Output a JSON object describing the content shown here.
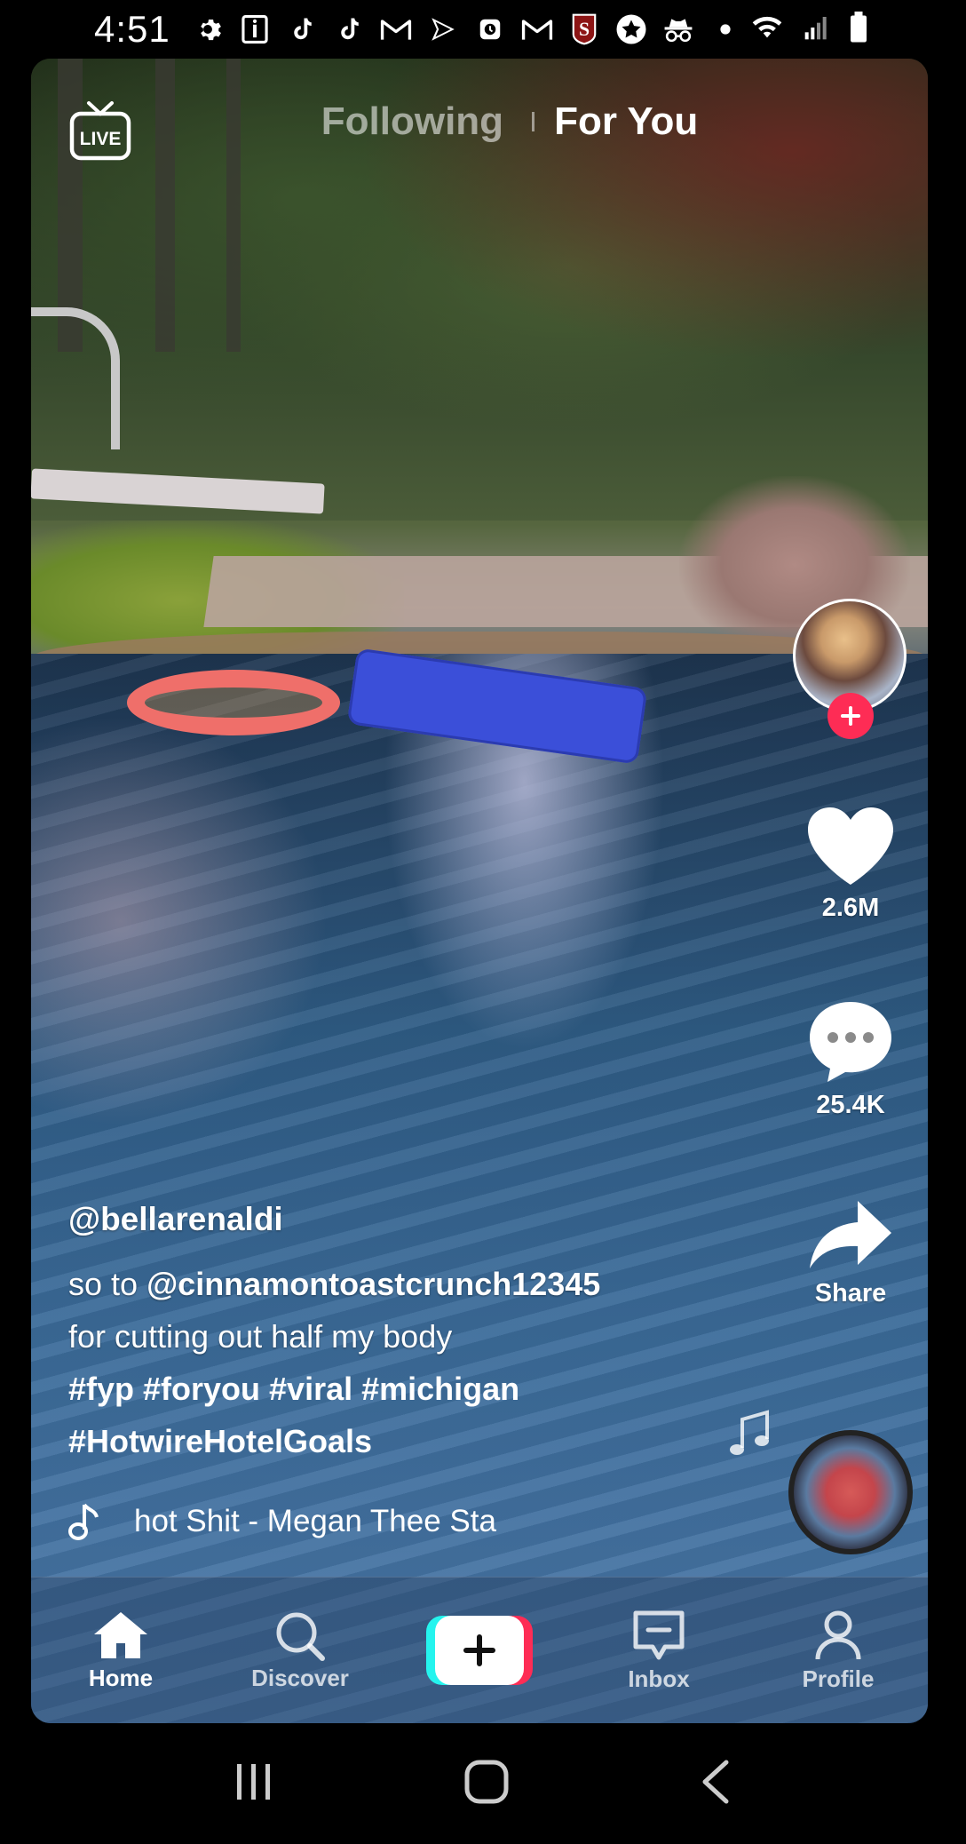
{
  "status_bar": {
    "time": "4:51",
    "icons": [
      "gear-icon",
      "id-icon",
      "tiktok-icon",
      "tiktok-icon",
      "gmail-icon",
      "plane-icon",
      "alarm-icon",
      "gmail-icon",
      "stanford-icon",
      "star-icon",
      "incognito-icon",
      "dot-icon"
    ],
    "right_icons": [
      "wifi-icon",
      "signal-icon",
      "battery-icon"
    ]
  },
  "top_nav": {
    "live_label": "LIVE",
    "tabs": [
      {
        "label": "Following",
        "active": false
      },
      {
        "label": "For You",
        "active": true
      }
    ]
  },
  "video": {
    "author": "@bellarenaldi",
    "caption_prefix": "so to ",
    "caption_mention": "@cinnamontoastcrunch12345",
    "caption_rest": "for cutting out half my body",
    "hashtags_line1": "#fyp #foryou #viral #michigan",
    "hashtags_line2": "#HotwireHotelGoals",
    "sound": "hot Shit - Megan Thee Sta"
  },
  "actions": {
    "likes": "2.6M",
    "comments": "25.4K",
    "share_label": "Share"
  },
  "bottom_nav": {
    "items": [
      {
        "label": "Home",
        "icon": "home-icon",
        "active": true
      },
      {
        "label": "Discover",
        "icon": "search-icon",
        "active": false
      },
      {
        "label": "",
        "icon": "plus-icon",
        "active": false
      },
      {
        "label": "Inbox",
        "icon": "inbox-icon",
        "active": false
      },
      {
        "label": "Profile",
        "icon": "profile-icon",
        "active": false
      }
    ]
  },
  "colors": {
    "accent_red": "#fe2c55",
    "accent_cyan": "#25f4ee"
  }
}
